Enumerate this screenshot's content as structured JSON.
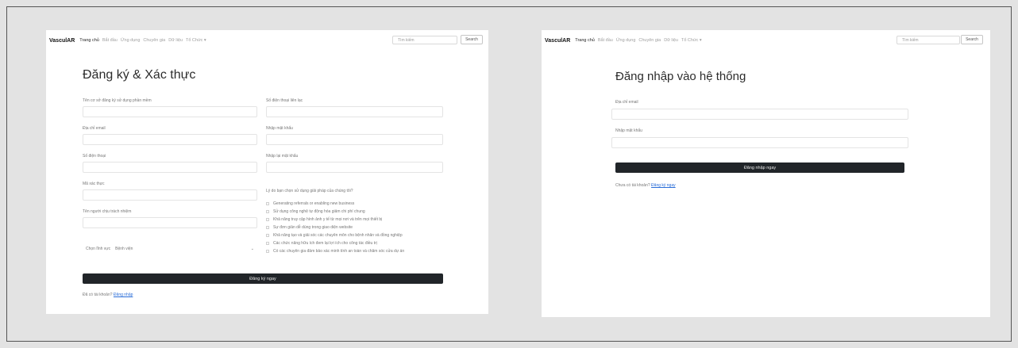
{
  "register": {
    "nav": {
      "brand": "VasculAR",
      "links": [
        "Trang chủ",
        "Bắt đầu",
        "Ứng dụng",
        "Chuyên gia",
        "Dữ liệu",
        "Tổ Chức ▾"
      ],
      "search_placeholder": "Tìm kiếm",
      "search_button": "Search"
    },
    "title": "Đăng ký & Xác thực",
    "fields": {
      "facility_name": "Tên cơ sở đăng ký sử dụng phần mềm",
      "contact_phone": "Số điện thoại liên lạc",
      "email": "Địa chỉ email",
      "password": "Nhập mật khẩu",
      "phone": "Số điện thoại",
      "confirm_password": "Nhập lại mật khẩu",
      "tax_code": "Mã xác thực",
      "manager_name": "Tên người chịu trách nhiệm"
    },
    "select": {
      "label": "Chọn lĩnh vực",
      "value": "Bệnh viện"
    },
    "reasons_question": "Lý do bạn chọn sử dụng giải pháp của chúng tôi?",
    "reasons": [
      "Generating referrals or enabling new business",
      "Sử dụng công nghệ tự động hóa giảm chi phí chung",
      "Khả năng truy cập hình ảnh y tế từ mọi nơi và trên mọi thiết bị",
      "Sự đơn giản dễ dùng trong giao diện website",
      "Khả năng tạo và giải sóc các chuyên môn cho bệnh nhân và đồng nghiệp",
      "Các chức năng hữu ích đem lại lợi ích cho công tác điều trị",
      "Có các chuyên gia đảm bảo xác minh tính an toàn và chăm sóc cửa dự án"
    ],
    "submit": "Đăng ký ngay",
    "footer_text": "Đã có tài khoản?",
    "footer_link": "Đăng nhập"
  },
  "login": {
    "nav": {
      "brand": "VasculAR",
      "links": [
        "Trang chủ",
        "Bắt đầu",
        "Ứng dụng",
        "Chuyên gia",
        "Dữ liệu",
        "Tổ Chức ▾"
      ],
      "search_placeholder": "Tìm kiếm",
      "search_button": "Search"
    },
    "title": "Đăng nhập vào hệ thống",
    "email_label": "Địa chỉ email",
    "password_label": "Nhập mật khẩu",
    "submit": "Đăng nhập ngay",
    "footer_text": "Chưa có tài khoản?",
    "footer_link": "Đăng ký ngay"
  }
}
